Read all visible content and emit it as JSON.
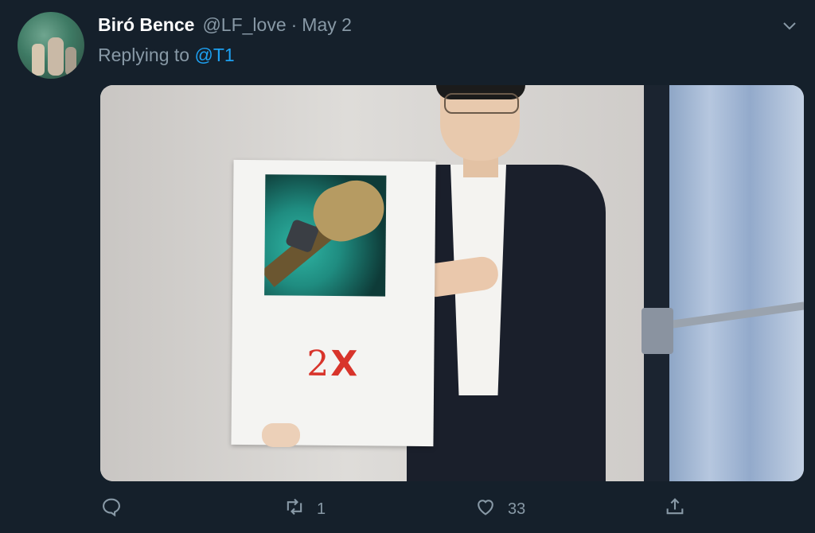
{
  "tweet": {
    "author_name": "Biró Bence",
    "handle": "@LF_love",
    "separator": "·",
    "date": "May 2",
    "replying_prefix": "Replying to",
    "replying_to": "@T1",
    "media": {
      "card_text_number": "2",
      "card_text_x": "X"
    },
    "actions": {
      "reply_count": "",
      "retweet_count": "1",
      "like_count": "33"
    }
  },
  "icons": {
    "menu": "chevron-down-icon",
    "reply": "reply-icon",
    "retweet": "retweet-icon",
    "like": "heart-icon",
    "share": "share-icon"
  },
  "colors": {
    "background": "#15202b",
    "secondary_text": "#8899a6",
    "accent": "#1da1f2",
    "card_text": "#d8342b"
  }
}
